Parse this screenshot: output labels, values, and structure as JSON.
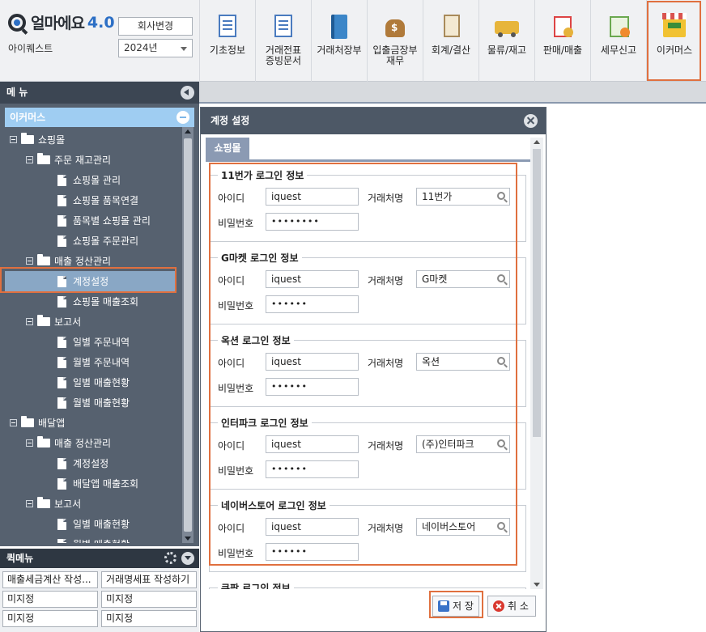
{
  "brand": {
    "name": "얼마에요",
    "version": "4.0"
  },
  "company": {
    "name": "아이퀘스트",
    "change_label": "회사변경",
    "year": "2024년"
  },
  "toolbar": [
    {
      "label": "기초정보",
      "icon": "basic-info-icon"
    },
    {
      "label": "거래전표\n증빙문서",
      "icon": "voucher-icon"
    },
    {
      "label": "거래처장부",
      "icon": "ledger-book-icon"
    },
    {
      "label": "입출금장부\n재무",
      "icon": "money-bag-icon"
    },
    {
      "label": "회계/결산",
      "icon": "accounting-icon"
    },
    {
      "label": "물류/재고",
      "icon": "logistics-icon"
    },
    {
      "label": "판매/매출",
      "icon": "sales-icon"
    },
    {
      "label": "세무신고",
      "icon": "tax-icon"
    },
    {
      "label": "이커머스",
      "icon": "ecommerce-shop-icon",
      "active": true
    }
  ],
  "menu": {
    "title": "메 뉴",
    "section": "이커머스",
    "tree": [
      {
        "label": "쇼핑몰",
        "kind": "folder",
        "level": 0
      },
      {
        "label": "주문 재고관리",
        "kind": "folder",
        "level": 1
      },
      {
        "label": "쇼핑몰 관리",
        "kind": "page",
        "level": 2
      },
      {
        "label": "쇼핑몰 품목연결",
        "kind": "page",
        "level": 2
      },
      {
        "label": "품목별 쇼핑몰 관리",
        "kind": "page",
        "level": 2
      },
      {
        "label": "쇼핑몰 주문관리",
        "kind": "page",
        "level": 2
      },
      {
        "label": "매출 정산관리",
        "kind": "folder",
        "level": 1
      },
      {
        "label": "계정설정",
        "kind": "page",
        "level": 2,
        "selected": true
      },
      {
        "label": "쇼핑몰 매출조회",
        "kind": "page",
        "level": 2
      },
      {
        "label": "보고서",
        "kind": "folder",
        "level": 1
      },
      {
        "label": "일별 주문내역",
        "kind": "page",
        "level": 2
      },
      {
        "label": "월별 주문내역",
        "kind": "page",
        "level": 2
      },
      {
        "label": "일별 매출현황",
        "kind": "page",
        "level": 2
      },
      {
        "label": "월별 매출현황",
        "kind": "page",
        "level": 2
      },
      {
        "label": "배달앱",
        "kind": "folder",
        "level": 0
      },
      {
        "label": "매출 정산관리",
        "kind": "folder",
        "level": 1
      },
      {
        "label": "계정설정",
        "kind": "page",
        "level": 2
      },
      {
        "label": "배달앱 매출조회",
        "kind": "page",
        "level": 2
      },
      {
        "label": "보고서",
        "kind": "folder",
        "level": 1
      },
      {
        "label": "일별 매출현황",
        "kind": "page",
        "level": 2
      },
      {
        "label": "월별 매출현황",
        "kind": "page",
        "level": 2
      }
    ]
  },
  "quick_menu": {
    "title": "퀵메뉴",
    "items": [
      "매출세금계산 작성...",
      "거래명세표 작성하기",
      "미지정",
      "미지정",
      "미지정",
      "미지정"
    ]
  },
  "dialog": {
    "title": "계정 설정",
    "tab": "쇼핑몰",
    "labels": {
      "id": "아이디",
      "vendor": "거래처명",
      "password": "비밀번호"
    },
    "groups": [
      {
        "title": "11번가 로그인 정보",
        "id": "iquest",
        "vendor": "11번가",
        "password": "••••••••"
      },
      {
        "title": "G마켓 로그인 정보",
        "id": "iquest",
        "vendor": "G마켓",
        "password": "••••••"
      },
      {
        "title": "옥션 로그인 정보",
        "id": "iquest",
        "vendor": "옥션",
        "password": "••••••"
      },
      {
        "title": "인터파크 로그인 정보",
        "id": "iquest",
        "vendor": "(주)인터파크",
        "password": "••••••"
      },
      {
        "title": "네이버스토어 로그인 정보",
        "id": "iquest",
        "vendor": "네이버스토어",
        "password": "••••••"
      },
      {
        "title": "쿠팡 로그인 정보",
        "id": "",
        "vendor": "",
        "password": ""
      }
    ],
    "save_label": "저 장",
    "cancel_label": "취 소"
  },
  "colors": {
    "highlight": "#e0703f",
    "sidebar_bg": "#56616f",
    "tree_header": "#9fcdf2",
    "dialog_title": "#4d5866"
  }
}
